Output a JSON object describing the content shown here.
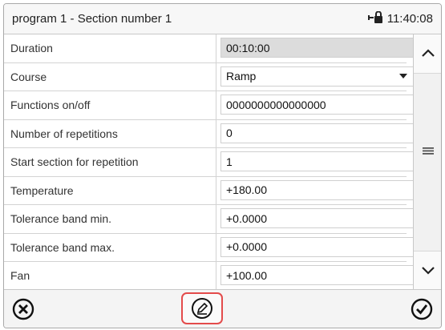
{
  "header": {
    "title": "program 1 - Section number 1",
    "time": "11:40:08",
    "lock_icon": "lock-network-icon"
  },
  "rows": [
    {
      "label": "Duration",
      "value": "00:10:00",
      "type": "readonly"
    },
    {
      "label": "Course",
      "value": "Ramp",
      "type": "select"
    },
    {
      "label": "Functions on/off",
      "value": "0000000000000000",
      "type": "input"
    },
    {
      "label": "Number of repetitions",
      "value": "0",
      "type": "input"
    },
    {
      "label": "Start section for repetition",
      "value": "1",
      "type": "input"
    },
    {
      "label": "Temperature",
      "value": "+180.00",
      "type": "input"
    },
    {
      "label": "Tolerance band min.",
      "value": "+0.0000",
      "type": "input"
    },
    {
      "label": "Tolerance band max.",
      "value": "+0.0000",
      "type": "input"
    },
    {
      "label": "Fan",
      "value": "+100.00",
      "type": "input"
    }
  ],
  "footer": {
    "cancel_icon": "close-circle-icon",
    "edit_icon": "pencil-edit-icon",
    "ok_icon": "checkmark-circle-icon",
    "highlight_color": "#e34b4b"
  }
}
